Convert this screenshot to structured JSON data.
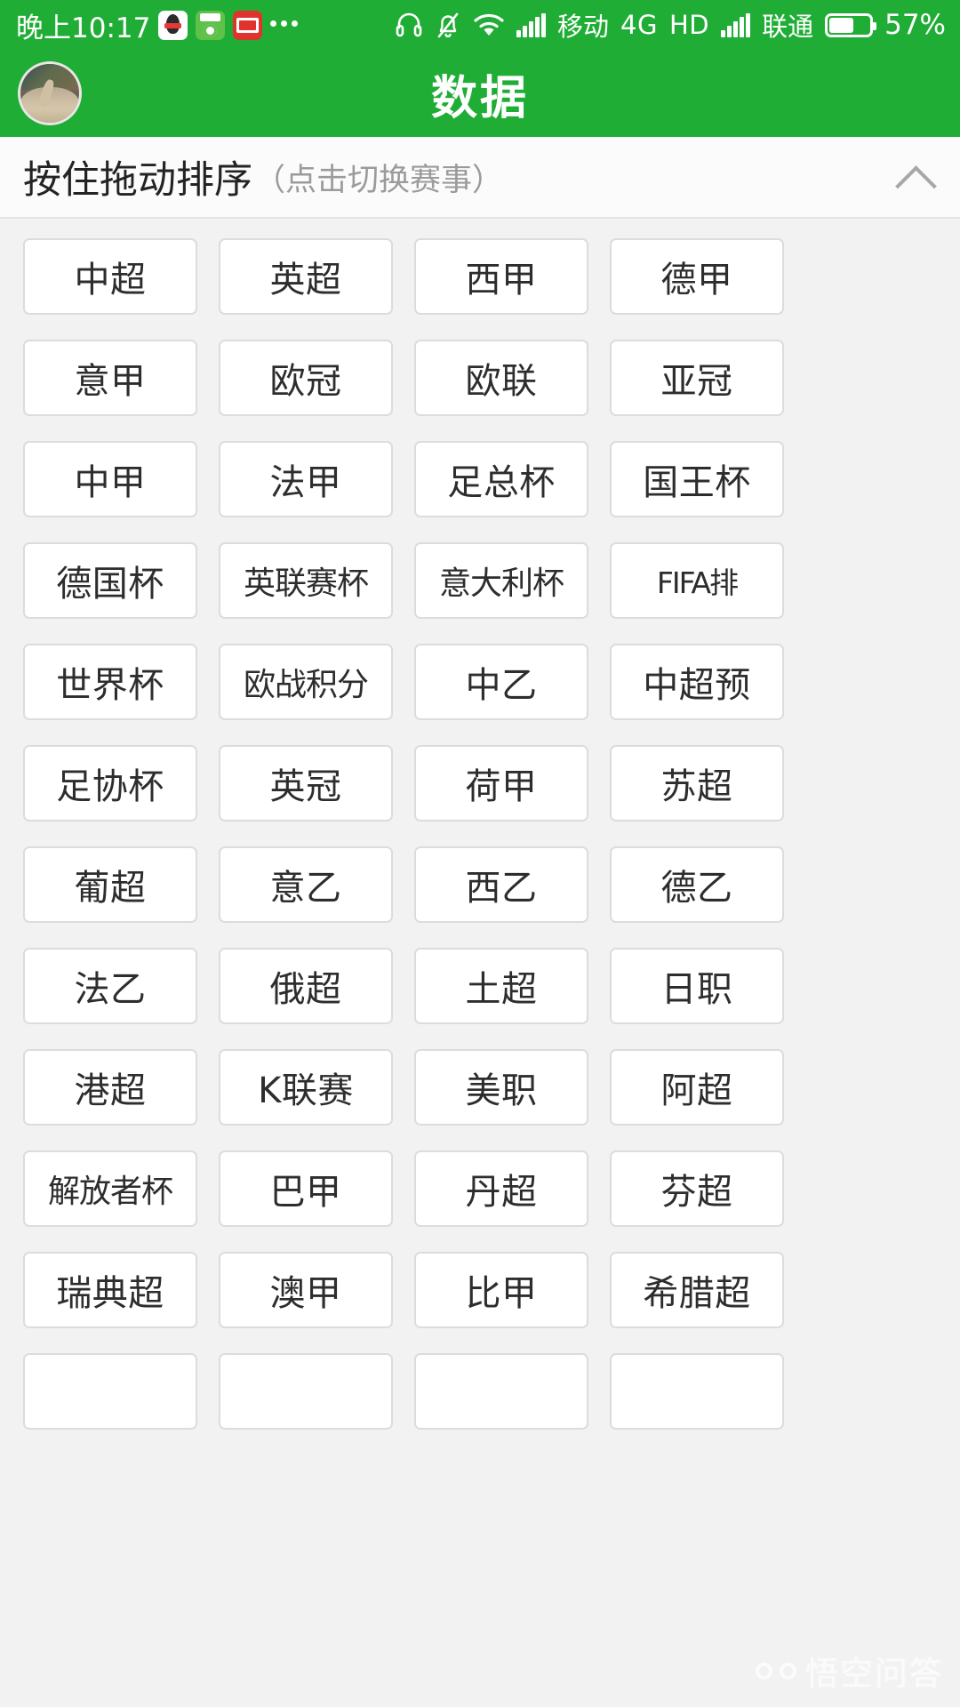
{
  "status_bar": {
    "clock": "晚上10:17",
    "app_badges": [
      "qq-icon",
      "football-app-icon",
      "toutiao-icon"
    ],
    "overflow_icon": "more-dots-icon",
    "headset_icon": "headset-icon",
    "silent_icon": "bell-muted-icon",
    "wifi_icon": "wifi-icon",
    "signal_icon_1": "signal-bars-icon",
    "carrier_1": "移动",
    "network_type": "4G",
    "hd_label": "HD",
    "signal_icon_2": "signal-bars-icon",
    "carrier_2": "联通",
    "battery_icon": "battery-icon",
    "battery_percent": "57%",
    "battery_level": 57
  },
  "title_bar": {
    "avatar": "user-avatar",
    "title": "数据"
  },
  "section_header": {
    "main_text": "按住拖动排序",
    "sub_text": "（点击切换赛事）",
    "collapse_icon": "chevron-up-icon"
  },
  "leagues": [
    "中超",
    "英超",
    "西甲",
    "德甲",
    "意甲",
    "欧冠",
    "欧联",
    "亚冠",
    "中甲",
    "法甲",
    "足总杯",
    "国王杯",
    "德国杯",
    "英联赛杯",
    "意大利杯",
    "FIFA排",
    "世界杯",
    "欧战积分",
    "中乙",
    "中超预",
    "足协杯",
    "英冠",
    "荷甲",
    "苏超",
    "葡超",
    "意乙",
    "西乙",
    "德乙",
    "法乙",
    "俄超",
    "土超",
    "日职",
    "港超",
    "K联赛",
    "美职",
    "阿超",
    "解放者杯",
    "巴甲",
    "丹超",
    "芬超",
    "瑞典超",
    "澳甲",
    "比甲",
    "希腊超",
    "",
    "",
    "",
    ""
  ],
  "watermark": {
    "logo": "wukong-logo-icon",
    "text": "悟空问答"
  },
  "colors": {
    "brand_green": "#20ad36",
    "page_background": "#f2f2f2",
    "cell_background": "#ffffff",
    "cell_border": "#dcdcdc",
    "text_primary": "#2d2d2d",
    "text_muted": "#9b9b9b"
  }
}
